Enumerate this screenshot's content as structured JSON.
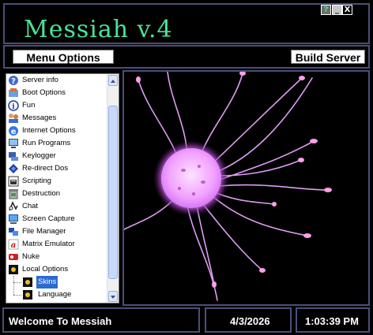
{
  "window": {
    "title": "Messiah v.4",
    "buttons": {
      "help": "?",
      "minimize": "_",
      "close": "X"
    }
  },
  "toolbar": {
    "menu_options": "Menu Options",
    "build_server": "Build Server"
  },
  "tree": {
    "items": [
      {
        "label": "Server info",
        "icon": "question-icon"
      },
      {
        "label": "Boot Options",
        "icon": "boot-icon"
      },
      {
        "label": "Fun",
        "icon": "info-icon"
      },
      {
        "label": "Messages",
        "icon": "messages-icon"
      },
      {
        "label": "Internet Options",
        "icon": "ie-icon"
      },
      {
        "label": "Run Programs",
        "icon": "run-icon"
      },
      {
        "label": "Keylogger",
        "icon": "keylogger-icon"
      },
      {
        "label": "Re-direct Dos",
        "icon": "redirect-icon"
      },
      {
        "label": "Scripting",
        "icon": "scripting-icon"
      },
      {
        "label": "Destruction",
        "icon": "destruction-icon"
      },
      {
        "label": "Chat",
        "icon": "chat-icon"
      },
      {
        "label": "Screen Capture",
        "icon": "screen-capture-icon"
      },
      {
        "label": "File Manager",
        "icon": "file-manager-icon"
      },
      {
        "label": "Matrix Emulator",
        "icon": "matrix-icon"
      },
      {
        "label": "Nuke",
        "icon": "nuke-icon"
      },
      {
        "label": "Local Options",
        "icon": "local-options-icon"
      }
    ],
    "children": [
      {
        "label": "Skins",
        "icon": "skins-icon",
        "selected": true
      },
      {
        "label": "Language",
        "icon": "language-icon",
        "selected": false
      }
    ]
  },
  "status": {
    "message": "Welcome To Messiah",
    "date": "4/3/2026",
    "time": "1:03:39 PM"
  },
  "colors": {
    "title": "#49e39a",
    "frame": "#4a4f78",
    "selection": "#2b6bd1",
    "plasma": "#f1a8ff"
  }
}
